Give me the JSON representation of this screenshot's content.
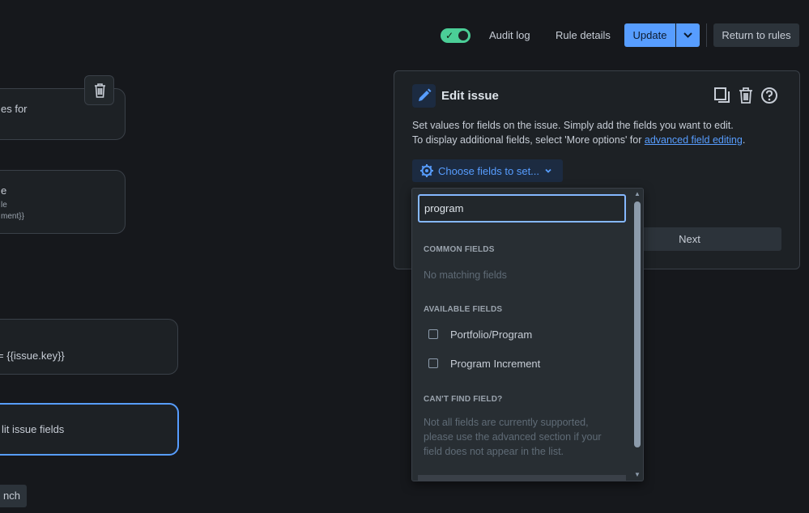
{
  "toolbar": {
    "audit_log": "Audit log",
    "rule_details": "Rule details",
    "update": "Update",
    "return_to_rules": "Return to rules",
    "toggle_enabled": true
  },
  "canvas": {
    "cards": [
      {
        "line1": "es for"
      },
      {
        "line1": "e",
        "line2": "le",
        "line3": "ment}}"
      },
      {
        "line1": "= {{issue.key}}"
      },
      {
        "line1": "lit issue fields"
      }
    ],
    "branch_label": "nch"
  },
  "panel": {
    "title": "Edit issue",
    "desc_line1": "Set values for fields on the issue. Simply add the fields you want to edit.",
    "desc_line2_prefix": "To display additional fields, select 'More options' for ",
    "desc_line2_link": "advanced field editing",
    "desc_line2_suffix": ".",
    "choose_fields": "Choose fields to set...",
    "next": "Next"
  },
  "dropdown": {
    "search_value": "program",
    "common_heading": "COMMON FIELDS",
    "no_matching": "No matching fields",
    "available_heading": "AVAILABLE FIELDS",
    "options": [
      "Portfolio/Program",
      "Program Increment"
    ],
    "cant_find_heading": "CAN'T FIND FIELD?",
    "note_line1": "Not all fields are currently supported,",
    "note_line2": "please use the advanced section if your",
    "note_line3": "field does not appear in the list."
  },
  "colors": {
    "accent": "#579dff",
    "toggle_on": "#4bce97",
    "background": "#16181c"
  }
}
